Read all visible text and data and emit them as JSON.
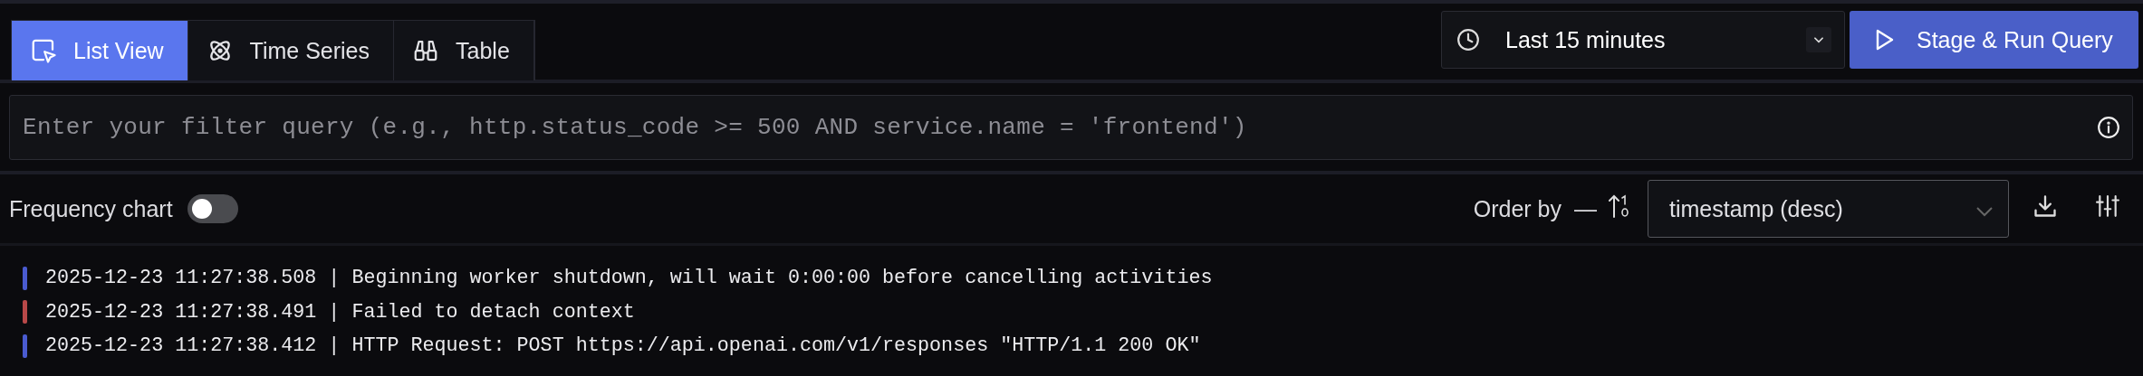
{
  "tabs": [
    {
      "label": "List View",
      "selected": true
    },
    {
      "label": "Time Series",
      "selected": false
    },
    {
      "label": "Table",
      "selected": false
    }
  ],
  "time_range": {
    "value": "Last 15 minutes"
  },
  "run_button": {
    "label": "Stage & Run Query"
  },
  "filter": {
    "placeholder": "Enter your filter query (e.g., http.status_code >= 500 AND service.name = 'frontend')"
  },
  "frequency_chart": {
    "label": "Frequency chart",
    "on": false
  },
  "order_by": {
    "label": "Order by",
    "separator": "—",
    "value": "timestamp (desc)"
  },
  "logs": [
    {
      "text": "2025-12-23 11:27:38.508 | Beginning worker shutdown, will wait 0:00:00 before cancelling activities",
      "color": "#4a5bd0"
    },
    {
      "text": "2025-12-23 11:27:38.491 | Failed to detach context",
      "color": "#b84848"
    },
    {
      "text": "2025-12-23 11:27:38.412 | HTTP Request: POST https://api.openai.com/v1/responses \"HTTP/1.1 200 OK\"",
      "color": "#4a5bd0"
    }
  ]
}
